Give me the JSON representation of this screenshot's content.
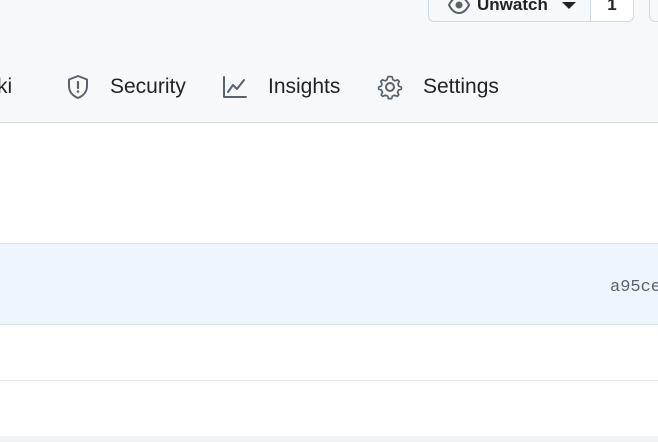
{
  "header": {
    "watch": {
      "label": "Unwatch",
      "count": "1",
      "icon": "eye-icon",
      "caret_icon": "triangle-down-icon"
    },
    "tabs": [
      {
        "label": "ki",
        "icon": null
      },
      {
        "label": "Security",
        "icon": "shield-icon"
      },
      {
        "label": "Insights",
        "icon": "graph-icon"
      },
      {
        "label": "Settings",
        "icon": "gear-icon"
      }
    ]
  },
  "main": {
    "commit_row": {
      "sha": "a95ce"
    }
  },
  "colors": {
    "header_bg": "#f6f8fa",
    "highlight_row_bg": "#eef5fd",
    "border": "#d1d9e0",
    "text": "#1f2328",
    "muted_text": "#59636e"
  }
}
